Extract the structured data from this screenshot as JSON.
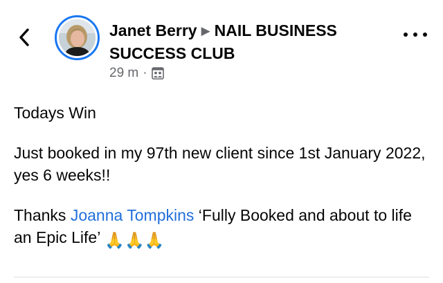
{
  "header": {
    "back_icon": "chevron-left-icon",
    "author_name": "Janet Berry",
    "arrow_glyph": "▶",
    "group_name_line1": "NAIL BUSINESS",
    "group_name_line2": "SUCCESS CLUB",
    "timestamp": "29 m",
    "separator": "·",
    "audience_icon": "group-members-icon",
    "more_icon": "more-options-icon",
    "avatar_ring_color": "#1877f2"
  },
  "post": {
    "line1": "Todays Win",
    "line2": "Just booked in my 97th new client since 1st January 2022, yes 6 weeks!!",
    "thanks_prefix": "Thanks ",
    "mention": "Joanna Tompkins",
    "quote": " ‘Fully Booked and about to life an Epic Life’",
    "emoji": "🙏🙏🙏",
    "mention_color": "#216fdb"
  }
}
